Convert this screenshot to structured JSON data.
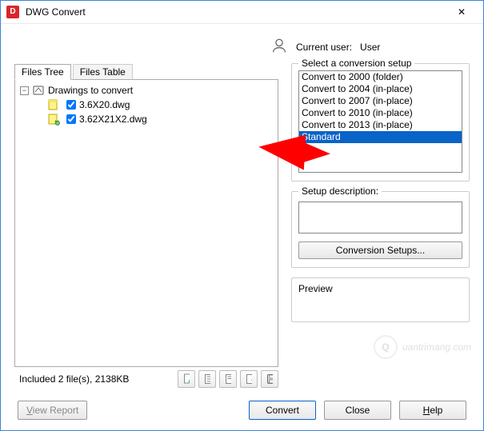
{
  "window": {
    "title": "DWG Convert",
    "appicon_letter": "D",
    "close_glyph": "✕"
  },
  "user": {
    "label": "Current user:",
    "name": "User"
  },
  "tabs": {
    "tree": "Files Tree",
    "table": "Files Table"
  },
  "tree": {
    "root": "Drawings to convert",
    "files": [
      {
        "name": "3.6X20.dwg",
        "checked": true
      },
      {
        "name": "3.62X21X2.dwg",
        "checked": true
      }
    ]
  },
  "status": {
    "text": "Included 2 file(s), 2138KB"
  },
  "toolbar": {
    "add": "add-file",
    "report": "report",
    "copy": "copy",
    "refresh": "refresh",
    "save": "save"
  },
  "setup": {
    "legend": "Select a conversion setup",
    "items": [
      "Convert to 2000 (folder)",
      "Convert to 2004 (in-place)",
      "Convert to 2007 (in-place)",
      "Convert to 2010 (in-place)",
      "Convert to 2013 (in-place)",
      "Standard"
    ],
    "selected_index": 5
  },
  "desc": {
    "legend": "Setup description:"
  },
  "setups_btn": "Conversion Setups...",
  "preview": {
    "legend": "Preview"
  },
  "buttons": {
    "view_report": "View Report",
    "convert": "Convert",
    "close": "Close",
    "help": "Help"
  },
  "watermark": "uantrimang.com"
}
